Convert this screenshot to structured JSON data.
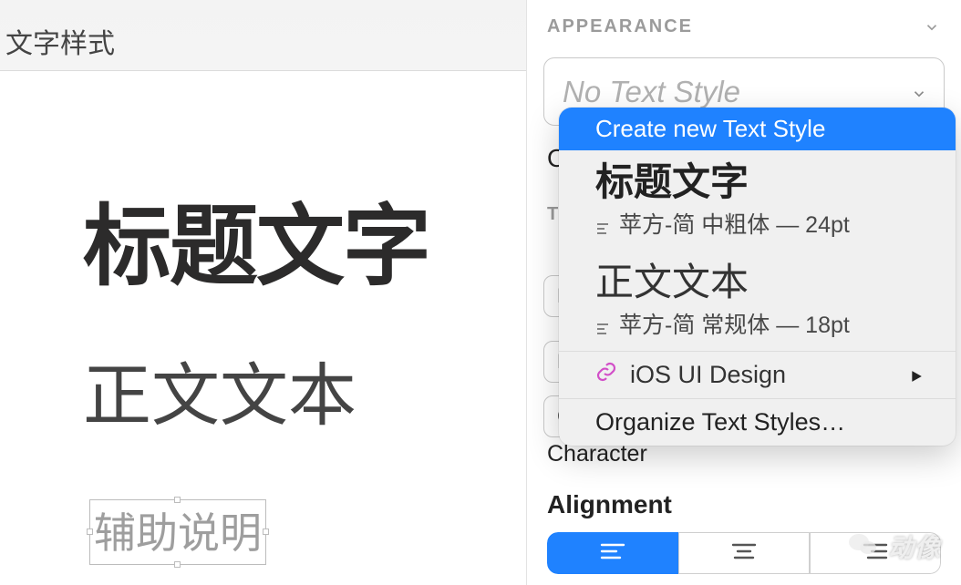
{
  "tab": {
    "title": "文字样式"
  },
  "canvas": {
    "heading": "标题文字",
    "body": "正文文本",
    "aux": "辅助说明"
  },
  "inspector": {
    "appearance_label": "APPEARANCE",
    "no_text_style": "No Text Style",
    "opacity_label": "Opacity",
    "typeface_label": "TYPEFACE",
    "font_letter": "F",
    "weight_letter": "L",
    "char_letter": "C",
    "char_spacing_label": "Character",
    "alignment_label": "Alignment"
  },
  "dropdown": {
    "create_label": "Create new Text Style",
    "styles": [
      {
        "title": "标题文字",
        "meta": "苹方-简 中粗体 — 24pt"
      },
      {
        "title": "正文文本",
        "meta": "苹方-简 常规体 — 18pt"
      }
    ],
    "library_name": "iOS UI Design",
    "organize_label": "Organize Text Styles…"
  },
  "watermark": {
    "text": "动像"
  }
}
